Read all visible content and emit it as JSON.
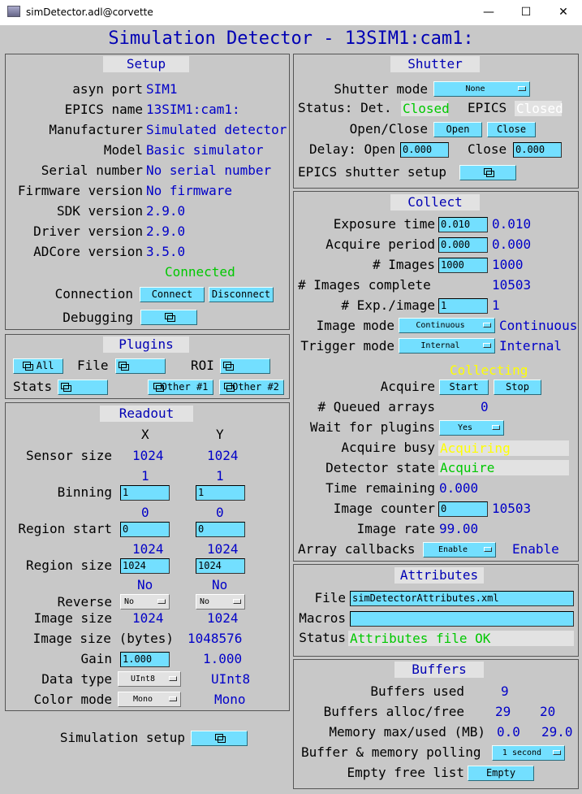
{
  "window": {
    "title": "simDetector.adl@corvette",
    "minimize": "—",
    "maximize": "☐",
    "close": "✕"
  },
  "main_title": "Simulation Detector - 13SIM1:cam1:",
  "setup": {
    "title": "Setup",
    "rows": [
      {
        "label": "asyn port",
        "value": "SIM1"
      },
      {
        "label": "EPICS name",
        "value": "13SIM1:cam1:"
      },
      {
        "label": "Manufacturer",
        "value": "Simulated detector"
      },
      {
        "label": "Model",
        "value": "Basic simulator"
      },
      {
        "label": "Serial number",
        "value": "No serial number"
      },
      {
        "label": "Firmware version",
        "value": "No firmware"
      },
      {
        "label": "SDK version",
        "value": "2.9.0"
      },
      {
        "label": "Driver version",
        "value": "2.9.0"
      },
      {
        "label": "ADCore version",
        "value": "3.5.0"
      }
    ],
    "connected": "Connected",
    "connection_label": "Connection",
    "connect": "Connect",
    "disconnect": "Disconnect",
    "debugging_label": "Debugging"
  },
  "plugins": {
    "title": "Plugins",
    "all": "All",
    "file_label": "File",
    "roi_label": "ROI",
    "stats_label": "Stats",
    "other1": "Other #1",
    "other2": "Other #2"
  },
  "readout": {
    "title": "Readout",
    "x_header": "X",
    "y_header": "Y",
    "sensor_size_label": "Sensor size",
    "sensor_x": "1024",
    "sensor_y": "1024",
    "binning_label": "Binning",
    "binning_x_rbv": "1",
    "binning_y_rbv": "1",
    "binning_x": "1",
    "binning_y": "1",
    "region_start_label": "Region start",
    "start_x_rbv": "0",
    "start_y_rbv": "0",
    "start_x": "0",
    "start_y": "0",
    "region_size_label": "Region size",
    "size_x_rbv": "1024",
    "size_y_rbv": "1024",
    "size_x": "1024",
    "size_y": "1024",
    "reverse_label": "Reverse",
    "reverse_x_rbv": "No",
    "reverse_y_rbv": "No",
    "reverse_x": "No",
    "reverse_y": "No",
    "image_size_label": "Image size",
    "image_x": "1024",
    "image_y": "1024",
    "image_bytes_label": "Image size (bytes)",
    "image_bytes": "1048576",
    "gain_label": "Gain",
    "gain_input": "1.000",
    "gain_rbv": "1.000",
    "data_type_label": "Data type",
    "data_type": "UInt8",
    "data_type_rbv": "UInt8",
    "color_mode_label": "Color mode",
    "color_mode": "Mono",
    "color_mode_rbv": "Mono",
    "sim_setup_label": "Simulation setup"
  },
  "shutter": {
    "title": "Shutter",
    "mode_label": "Shutter mode",
    "mode": "None",
    "status_label": "Status: Det.",
    "det_status": "Closed",
    "epics_label": "EPICS",
    "epics_status": "Closed",
    "open_close_label": "Open/Close",
    "open": "Open",
    "close": "Close",
    "delay_label": "Delay: Open",
    "delay_open": "0.000",
    "close_label": "Close",
    "delay_close": "0.000",
    "epics_setup_label": "EPICS shutter setup"
  },
  "collect": {
    "title": "Collect",
    "exposure_label": "Exposure time",
    "exposure": "0.010",
    "exposure_rbv": "0.010",
    "period_label": "Acquire period",
    "period": "0.000",
    "period_rbv": "0.000",
    "images_label": "# Images",
    "images": "1000",
    "images_rbv": "1000",
    "complete_label": "# Images complete",
    "complete": "10503",
    "exp_image_label": "# Exp./image",
    "exp_image": "1",
    "exp_image_rbv": "1",
    "image_mode_label": "Image mode",
    "image_mode": "Continuous",
    "image_mode_rbv": "Continuous",
    "trigger_label": "Trigger mode",
    "trigger": "Internal",
    "trigger_rbv": "Internal",
    "collecting": "Collecting",
    "acquire_label": "Acquire",
    "start": "Start",
    "stop": "Stop",
    "queued_label": "# Queued arrays",
    "queued": "0",
    "wait_label": "Wait for plugins",
    "wait": "Yes",
    "busy_label": "Acquire busy",
    "busy": "Acquiring",
    "state_label": "Detector state",
    "state": "Acquire",
    "remaining_label": "Time remaining",
    "remaining": "0.000",
    "counter_label": "Image counter",
    "counter": "0",
    "counter_rbv": "10503",
    "rate_label": "Image rate",
    "rate": "99.00",
    "callbacks_label": "Array callbacks",
    "callbacks": "Enable",
    "callbacks_rbv": "Enable"
  },
  "attributes": {
    "title": "Attributes",
    "file_label": "File",
    "file": "simDetectorAttributes.xml",
    "macros_label": "Macros",
    "macros": "",
    "status_label": "Status",
    "status": "Attributes file OK"
  },
  "buffers": {
    "title": "Buffers",
    "used_label": "Buffers used",
    "used": "9",
    "alloc_label": "Buffers alloc/free",
    "alloc": "29",
    "free": "20",
    "memory_label": "Memory max/used (MB)",
    "mem_max": "0.0",
    "mem_used": "29.0",
    "polling_label": "Buffer & memory polling",
    "polling": "1 second",
    "empty_label": "Empty free list",
    "empty": "Empty"
  },
  "colors": {
    "background": "#c8c8c8",
    "label_blue": "#0000b4",
    "readback_blue": "#0000c8",
    "input_cyan": "#73dfff",
    "ok_green": "#00c800"
  }
}
